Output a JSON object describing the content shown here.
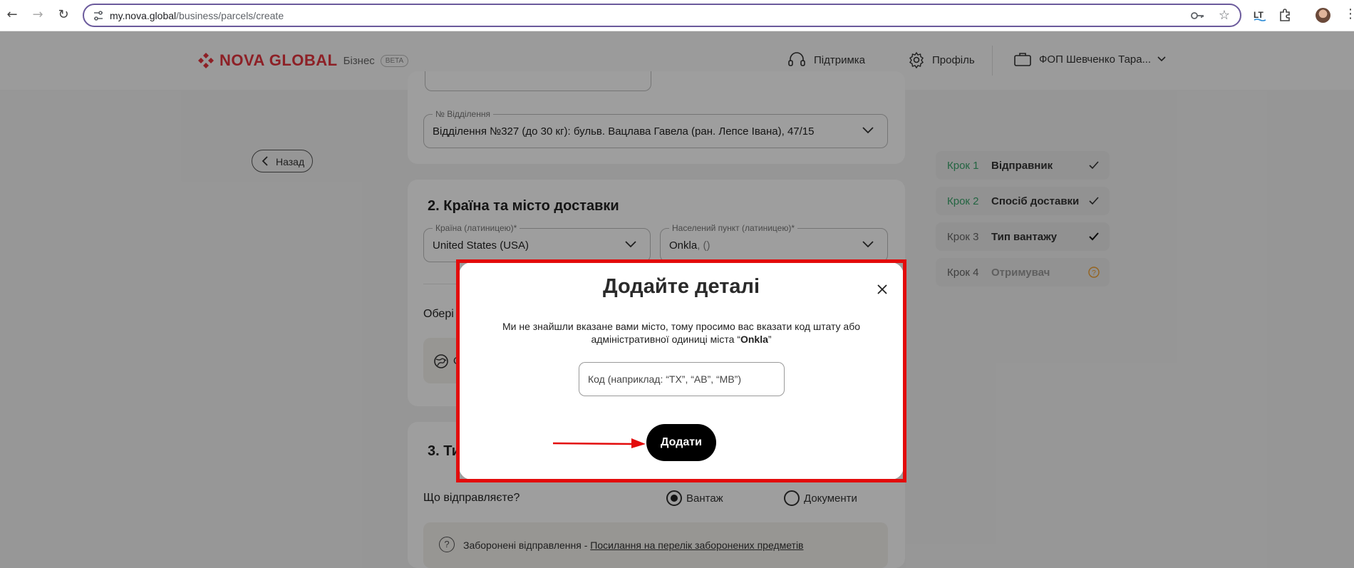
{
  "browser": {
    "url_host": "my.nova.global",
    "url_path": "/business/parcels/create"
  },
  "header": {
    "brand": "NOVA GLOBAL",
    "brand_sub": "Бізнес",
    "beta": "BETA",
    "support": "Підтримка",
    "profile": "Профіль",
    "account": "ФОП Шевченко Тара..."
  },
  "back": {
    "label": "Назад"
  },
  "branch": {
    "label": "№ Відділення",
    "value": "Відділення №327 (до 30 кг): бульв. Вацлава Гавела (ран. Лепсе Івана), 47/15"
  },
  "delivery": {
    "title": "2. Країна та місто доставки",
    "country_label": "Країна (латиницею)*",
    "country_value": "United States (USA)",
    "city_label": "Населений пункт (латиницею)*",
    "city_value": "Onkla",
    "city_suffix": ", ()",
    "choose_partial": "Обері",
    "option_partial": "О"
  },
  "section3": {
    "title_partial": "3. Ти",
    "question": "Що відправляєте?",
    "options": [
      "Вантаж",
      "Документи"
    ],
    "selected": "Вантаж"
  },
  "notice": {
    "text": "Заборонені відправлення - ",
    "link": "Посилання на перелік заборонених предметів"
  },
  "steps": [
    {
      "num": "Крок 1",
      "name": "Відправник",
      "state": "done"
    },
    {
      "num": "Крок 2",
      "name": "Спосіб доставки",
      "state": "done"
    },
    {
      "num": "Крок 3",
      "name": "Тип вантажу",
      "state": "done"
    },
    {
      "num": "Крок 4",
      "name": "Отримувач",
      "state": "pending"
    }
  ],
  "modal": {
    "title": "Додайте деталі",
    "text_before": "Ми не знайшли вказане вами місто, тому просимо вас вказати код штату або адміністративної одиниці міста “",
    "city": "Onkla",
    "text_after": "”",
    "input_placeholder": "Код (наприклад: “TX”, “AB”, “MB”)",
    "input_value": "",
    "submit_label": "Додати"
  },
  "colors": {
    "brand_red": "#e4343e",
    "highlight_red": "#e30b0b",
    "step_done_green": "#3aa36b",
    "step_pending_orange": "#f0a030"
  }
}
